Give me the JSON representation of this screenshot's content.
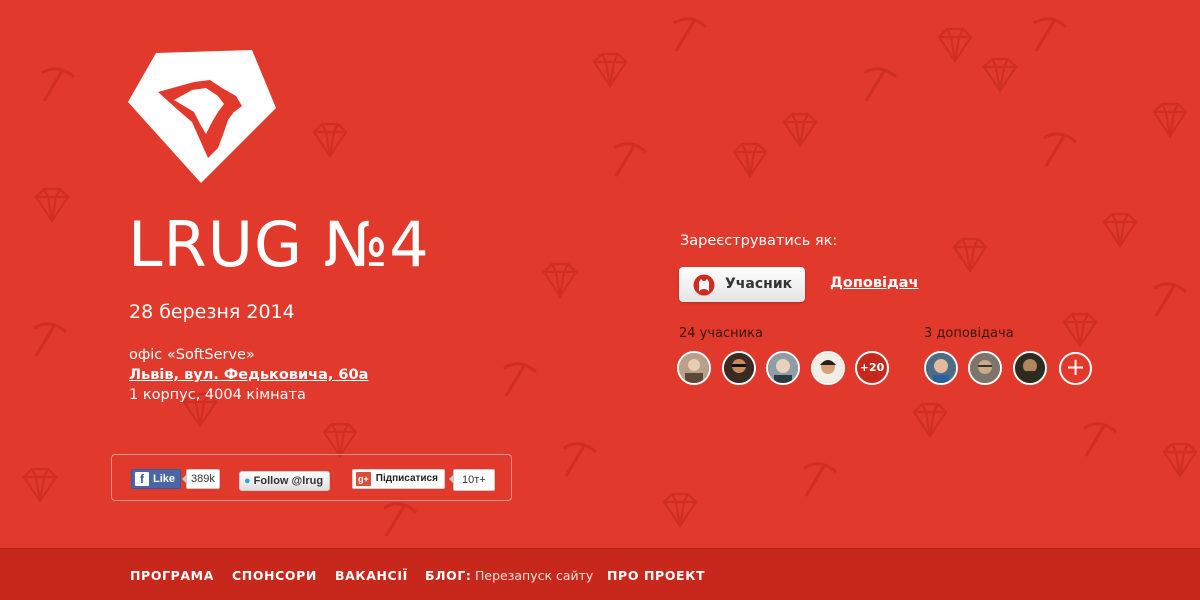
{
  "event": {
    "title": "LRUG №4",
    "date": "28 березня 2014",
    "office": "офіс «SoftServe»",
    "address": "Львів, вул. Федьковича, 60а",
    "room": "1 корпус, 4004 кімната"
  },
  "social": {
    "facebook_label": "Like",
    "facebook_icon": "f",
    "facebook_count": "389k",
    "twitter_label": "Follow @lrug",
    "gplus_icon": "g+",
    "gplus_label": "Підписатися",
    "gplus_count": "10т+"
  },
  "registration": {
    "label": "Зареєструватись як:",
    "member_button": "Учасник",
    "speaker_link": "Доповідач",
    "participants_count_label": "24 учасника",
    "participants_more": "+20",
    "speakers_count_label": "3 доповідача",
    "add_speaker": "+"
  },
  "nav": {
    "program": "ПРОГРАМА",
    "sponsors": "СПОНСОРИ",
    "jobs": "ВАКАНСІЇ",
    "blog": "БЛОГ:",
    "blog_post": "Перезапуск сайту",
    "about": "ПРО ПРОЕКТ"
  },
  "colors": {
    "background": "#e1392b",
    "footer": "#c8281c",
    "text": "#ffffff"
  },
  "icons": [
    "ruby-lion-logo",
    "github-icon",
    "facebook-icon",
    "twitter-icon",
    "gplus-icon"
  ]
}
